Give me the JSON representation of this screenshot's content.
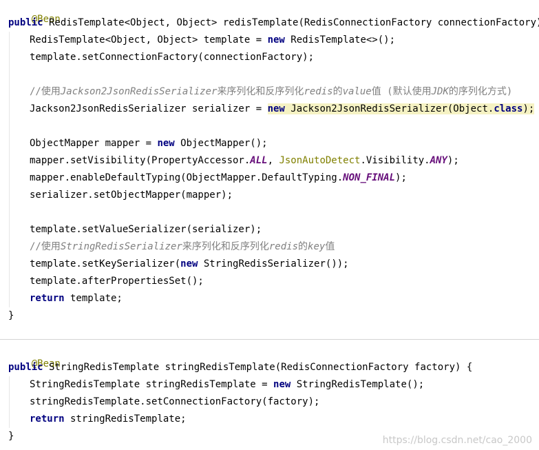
{
  "code": {
    "block1": {
      "annotation": "@Bean",
      "signature": {
        "kw": "public",
        "text": " RedisTemplate<Object, Object> redisTemplate(RedisConnectionFactory connectionFactory) {"
      },
      "l1": {
        "pre": "RedisTemplate<Object, Object> template = ",
        "kw": "new",
        "post": " RedisTemplate<>();"
      },
      "l2": "template.setConnectionFactory(connectionFactory);",
      "c1": {
        "p1": "//使用",
        "p2": "Jackson2JsonRedisSerializer",
        "p3": "来序列化和反序列化",
        "p4": "redis",
        "p5": "的",
        "p6": "value",
        "p7": "值 (默认使用",
        "p8": "JDK",
        "p9": "的序列化方式)"
      },
      "l3": {
        "pre": "Jackson2JsonRedisSerializer serializer = ",
        "kw": "new",
        "mid": " Jackson2JsonRedisSerializer(Object.",
        "kw2": "class",
        "post": ");"
      },
      "l4": {
        "pre": "ObjectMapper mapper = ",
        "kw": "new",
        "post": " ObjectMapper();"
      },
      "l5": {
        "pre": "mapper.setVisibility(PropertyAccessor.",
        "field": "ALL",
        "mid": ", ",
        "cls": "JsonAutoDetect",
        "mid2": ".Visibility.",
        "field2": "ANY",
        "post": ");"
      },
      "l6": {
        "pre": "mapper.enableDefaultTyping(ObjectMapper.DefaultTyping.",
        "field": "NON_FINAL",
        "post": ");"
      },
      "l7": "serializer.setObjectMapper(mapper);",
      "l8": "template.setValueSerializer(serializer);",
      "c2": {
        "p1": "//使用",
        "p2": "StringRedisSerializer",
        "p3": "来序列化和反序列化",
        "p4": "redis",
        "p5": "的",
        "p6": "key",
        "p7": "值"
      },
      "l9": {
        "pre": "template.setKeySerializer(",
        "kw": "new",
        "post": " StringRedisSerializer());"
      },
      "l10": "template.afterPropertiesSet();",
      "l11": {
        "kw": "return",
        "post": " template;"
      },
      "close": "}"
    },
    "block2": {
      "annotation": "@Bean",
      "signature": {
        "kw": "public",
        "text": " StringRedisTemplate stringRedisTemplate(RedisConnectionFactory factory) {"
      },
      "l1": {
        "pre": "StringRedisTemplate stringRedisTemplate = ",
        "kw": "new",
        "post": " StringRedisTemplate();"
      },
      "l2": "stringRedisTemplate.setConnectionFactory(factory);",
      "l3": {
        "kw": "return",
        "post": " stringRedisTemplate;"
      },
      "close": "}"
    }
  },
  "watermark": "https://blog.csdn.net/cao_2000",
  "colors": {
    "keyword": "#000080",
    "annotation": "#808000",
    "comment": "#808080",
    "static_field": "#660e7a",
    "highlight": "#f5f2c3"
  }
}
